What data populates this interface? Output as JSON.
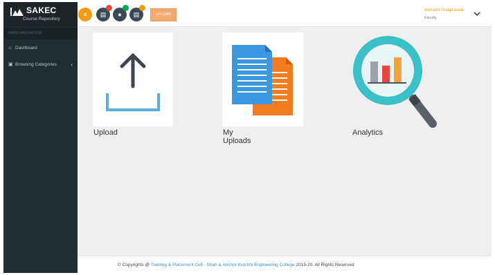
{
  "brand": {
    "title": "SAKEC",
    "subtitle": "Course Repository"
  },
  "sidebar": {
    "header": "MAIN NAVIGATION",
    "items": [
      {
        "label": "Dashboard",
        "icon": "home-icon"
      },
      {
        "label": "Browsing Categories",
        "icon": "laptop-icon",
        "has_submenu": true
      }
    ]
  },
  "topbar": {
    "menu_icon": "menu-icon",
    "notifications": [
      {
        "icon": "document-icon",
        "badge_color": "#dd4b39"
      },
      {
        "icon": "user-icon",
        "badge_color": "#00a65a"
      },
      {
        "icon": "list-icon",
        "badge_color": "#f39c12"
      }
    ],
    "upload_label": "UPLOAD",
    "user": {
      "name": "Abirami Sivaprasad",
      "role": "Faculty"
    }
  },
  "tiles": [
    {
      "label": "Upload",
      "icon": "upload-icon"
    },
    {
      "label": "My Uploads",
      "icon": "documents-icon"
    },
    {
      "label": "Analytics",
      "icon": "analytics-icon"
    }
  ],
  "footer": {
    "prefix": "© Copyrights @ ",
    "link": "Training & Placement Cell - Shah & Anchor Kutchhi Engineering College",
    "suffix": " 2019-20. All Rights Reserved"
  },
  "colors": {
    "sidebar": "#222d32",
    "accent_orange": "#f39c12",
    "link_blue": "#3c8dbc",
    "upload_button": "#f5a86c"
  }
}
